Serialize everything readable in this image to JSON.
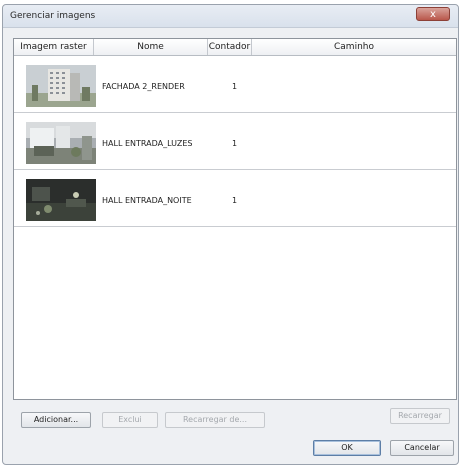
{
  "window": {
    "title": "Gerenciar imagens",
    "close_label": "x"
  },
  "table": {
    "columns": [
      "Imagem raster",
      "Nome",
      "Contador",
      "Caminho"
    ],
    "rows": [
      {
        "thumb_icon": "building-render-thumbnail",
        "name": "FACHADA 2_RENDER",
        "count": "1",
        "path": ""
      },
      {
        "thumb_icon": "hall-lights-thumbnail",
        "name": "HALL ENTRADA_LUZES",
        "count": "1",
        "path": ""
      },
      {
        "thumb_icon": "hall-night-thumbnail",
        "name": "HALL ENTRADA_NOITE",
        "count": "1",
        "path": ""
      }
    ]
  },
  "actions": {
    "add": "Adicionar...",
    "delete": "Exclui",
    "reload_from": "Recarregar de...",
    "reload": "Recarregar"
  },
  "dialog": {
    "ok": "OK",
    "cancel": "Cancelar"
  }
}
